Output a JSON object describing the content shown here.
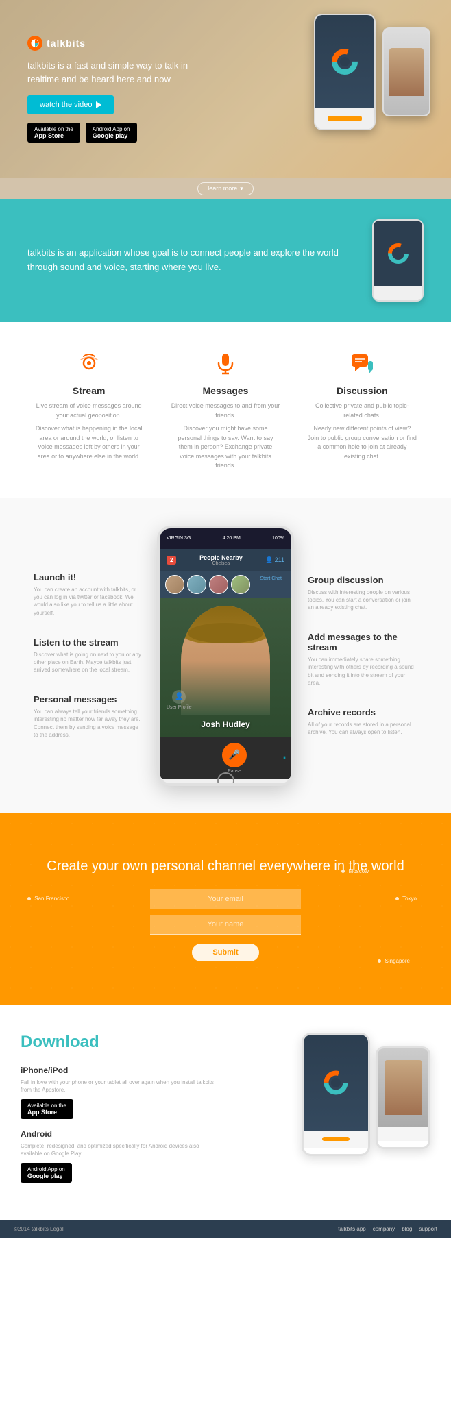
{
  "logo": {
    "text": "talkbits"
  },
  "hero": {
    "tagline": "talkbits is a fast and simple way to talk in realtime and be heard here and now",
    "watch_btn": "watch the video",
    "appstore_label": "Available on the",
    "appstore_name": "App Store",
    "googleplay_label": "Android App on",
    "googleplay_name": "Google play",
    "learn_more": "learn more"
  },
  "teal_section": {
    "text": "talkbits is an application whose goal is to connect people and explore the world through sound and voice, starting where you live."
  },
  "features": [
    {
      "id": "stream",
      "title": "Stream",
      "desc": "Live stream of voice messages around your actual geoposition.",
      "detail": "Discover what is happening in the local area or around the world, or listen to voice messages left by others in your area or to anywhere else in the world."
    },
    {
      "id": "messages",
      "title": "Messages",
      "desc": "Direct voice messages to and from your friends.",
      "detail": "Discover you might have some personal things to say. Want to say them in person? Exchange private voice messages with your talkbits friends."
    },
    {
      "id": "discussion",
      "title": "Discussion",
      "desc": "Collective private and public topic-related chats.",
      "detail": "Nearly new different points of view? Join to public group conversation or find a common hole to join at already existing chat."
    }
  ],
  "showcase": {
    "launch": {
      "title": "Launch it!",
      "desc": "You can create an account with talkbits, or you can log in via twitter or facebook. We would also like you to tell us a little about yourself."
    },
    "listen": {
      "title": "Listen to the stream",
      "desc": "Discover what is going on next to you or any other place on Earth. Maybe talkbits just arrived somewhere on the local stream."
    },
    "personal": {
      "title": "Personal messages",
      "desc": "You can always tell your friends something interesting no matter how far away they are. Connect them by sending a voice message to the address."
    },
    "group": {
      "title": "Group discussion",
      "desc": "Discuss with interesting people on various topics. You can start a conversation or join an already existing chat."
    },
    "add_messages": {
      "title": "Add messages to the stream",
      "desc": "You can immediately share something interesting with others by recording a sound bit and sending it into the stream of your area."
    },
    "archive": {
      "title": "Archive records",
      "desc": "All of your records are stored in a personal archive. You can always open to listen."
    },
    "phone": {
      "status_left": "VIRGIN 3G",
      "status_time": "4:20 PM",
      "status_right": "100%",
      "badge_count": "2",
      "nearby_title": "People Nearby",
      "nearby_sub": "Chelsea",
      "user_count": "211",
      "person_name": "Josh Hudley",
      "start_chat": "Start Chat",
      "user_profile": "User Profile",
      "mic_label": "Pause"
    }
  },
  "world": {
    "title": "Create your own personal channel everywhere in the world",
    "input1_placeholder": "Your email",
    "input2_placeholder": "Your name",
    "submit": "Submit",
    "cities": [
      "San Francisco",
      "Moscow",
      "Tokyo",
      "Singapore"
    ]
  },
  "download": {
    "title": "Download",
    "iphone_title": "iPhone/iPod",
    "iphone_desc": "Fall in love with your phone or your tablet all over again when you install talkbits from the Appstore.",
    "android_title": "Android",
    "android_desc": "Complete, redesigned, and optimized specifically for Android devices also available on Google Play."
  },
  "footer": {
    "copyright": "©2014 talkbits Legal",
    "links": [
      "talkbits app",
      "company",
      "blog",
      "support"
    ]
  }
}
